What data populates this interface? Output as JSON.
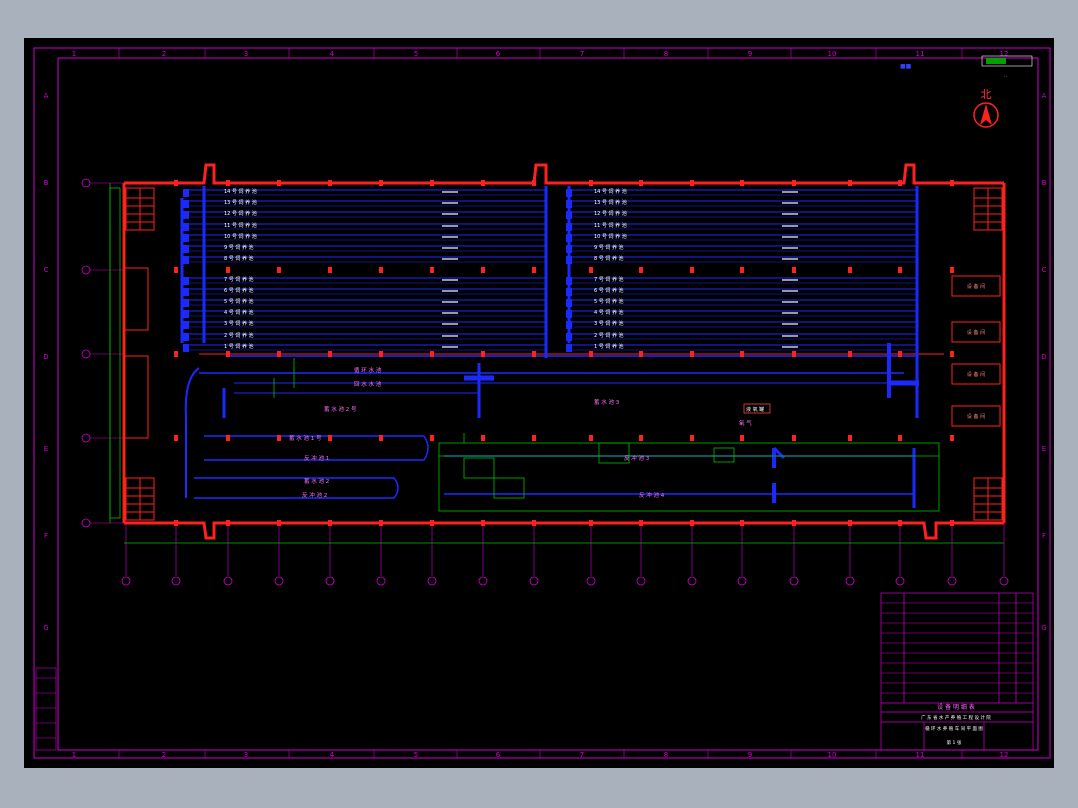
{
  "drawing": {
    "north_label": "北",
    "grid_columns": [
      "1",
      "2",
      "3",
      "4",
      "5",
      "6",
      "7",
      "8",
      "9",
      "10",
      "11",
      "12"
    ],
    "grid_rows": [
      "A",
      "B",
      "C",
      "D",
      "E",
      "F",
      "G"
    ],
    "left_pools": [
      "14 号 饲 养 池",
      "13 号 饲 养 池",
      "12 号 饲 养 池",
      "11 号 饲 养 池",
      "10 号 饲 养 池",
      "9 号 饲 养 池",
      "8 号 饲 养 池",
      "7 号 饲 养 池",
      "6 号 饲 养 池",
      "5 号 饲 养 池",
      "4 号 饲 养 池",
      "3 号 饲 养 池",
      "2 号 饲 养 池",
      "1 号 饲 养 池"
    ],
    "right_pools": [
      "14 号 饲 养 池",
      "13 号 饲 养 池",
      "12 号 饲 养 池",
      "11 号 饲 养 池",
      "10 号 饲 养 池",
      "9 号 饲 养 池",
      "8 号 饲 养 池",
      "7 号 饲 养 池",
      "6 号 饲 养 池",
      "5 号 饲 养 池",
      "4 号 饲 养 池",
      "3 号 饲 养 池",
      "2 号 饲 养 池",
      "1 号 饲 养 池"
    ],
    "right_rooms": [
      "设 备 间",
      "设 备 间",
      "设 备 间",
      "设 备 间"
    ],
    "title_block_heading": "设 备 明 细 表",
    "title_block_org": "广 东 省 水 产 养 殖 工 程 设 计 院",
    "title_block_drawing": "循 环 水 养 殖 车 间 平 面 图",
    "title_block_sheet": "第 1 张"
  }
}
